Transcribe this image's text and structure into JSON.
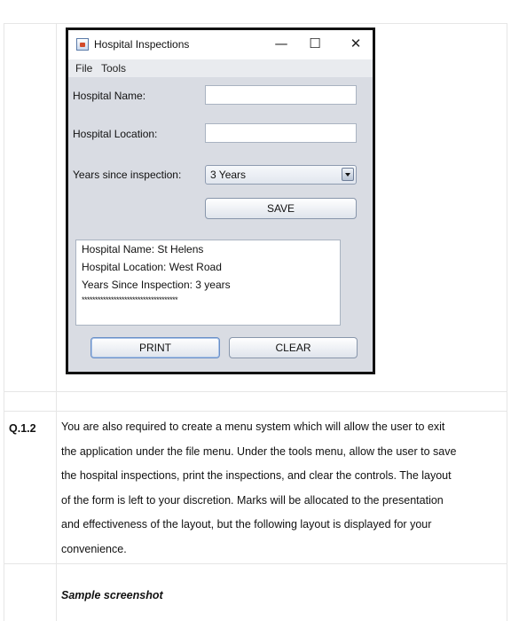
{
  "window": {
    "title": "Hospital Inspections",
    "controls": {
      "minimize": "—",
      "maximize": "☐",
      "close": "✕"
    },
    "menu": [
      "File",
      "Tools"
    ],
    "form": {
      "name_label": "Hospital Name:",
      "name_value": "",
      "location_label": "Hospital Location:",
      "location_value": "",
      "years_label": "Years since inspection:",
      "years_value": "3 Years",
      "save_button": "SAVE"
    },
    "output": {
      "line1": "Hospital Name: St Helens",
      "line2": "Hospital Location: West Road",
      "line3": "Years Since Inspection: 3 years",
      "separator": "************************************"
    },
    "print_button": "PRINT",
    "clear_button": "CLEAR"
  },
  "document": {
    "question_number": "Q.1.2",
    "paragraph_lines": [
      "You are also required to create a menu system which will allow the user to exit",
      "the application under the file menu. Under the tools menu, allow the user to save",
      "the hospital inspections, print the inspections, and clear the controls. The layout",
      "of the form is left to your discretion. Marks will be allocated to the presentation",
      "and effectiveness of the layout, but the following layout is displayed for your",
      "convenience."
    ],
    "caption": "Sample screenshot"
  }
}
